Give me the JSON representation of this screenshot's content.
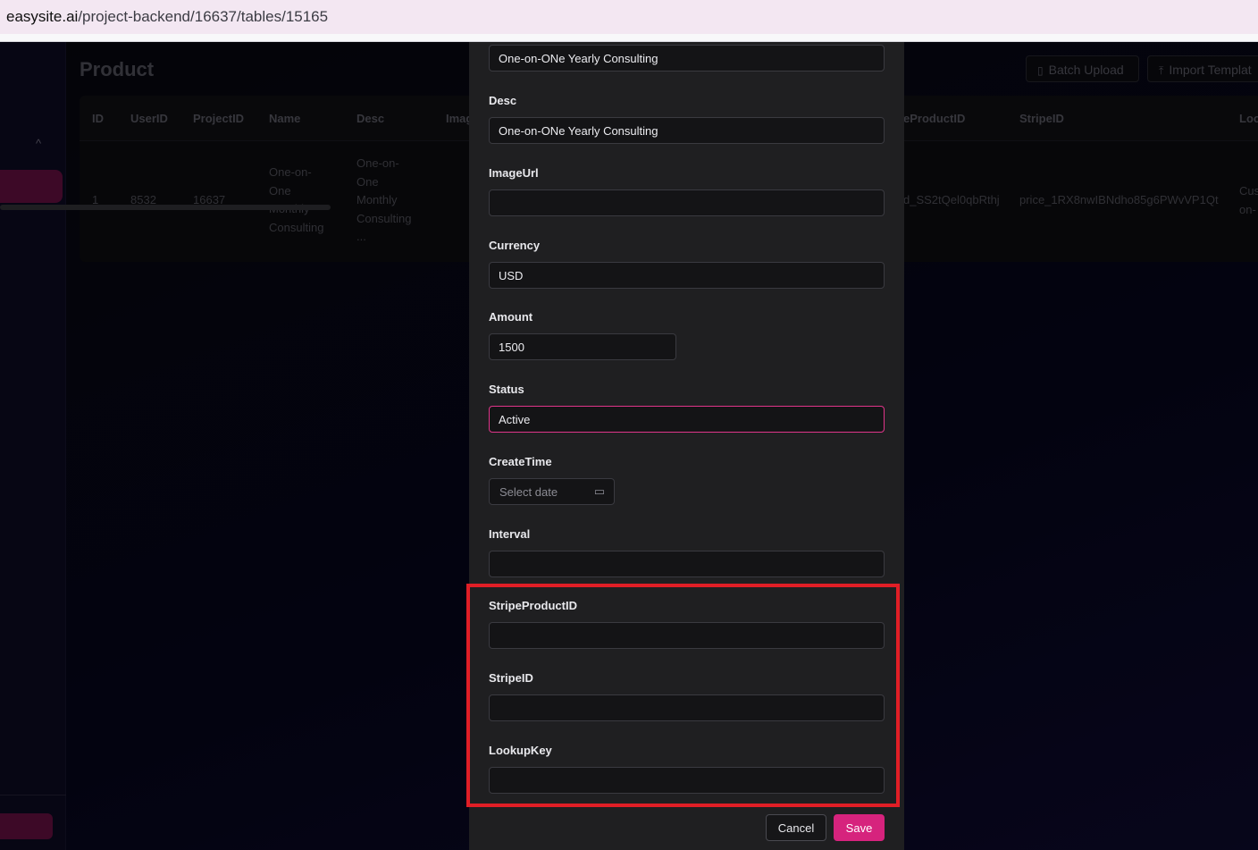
{
  "browser": {
    "url_host": "easysite.ai",
    "url_path": "/project-backend/16637/tables/15165"
  },
  "background": {
    "page_title": "Product",
    "buttons": {
      "batch_upload": "Batch Upload",
      "import_template": "Import Templat"
    },
    "table": {
      "headers": [
        "ID",
        "UserID",
        "ProjectID",
        "Name",
        "Desc",
        "Imag",
        "eProductID",
        "StripeID",
        "Loo"
      ],
      "row": {
        "id": "1",
        "user_id": "8532",
        "project_id": "16637",
        "name": "One-on-One Monthly Consulting",
        "desc": "One-on-One Monthly Consulting ...",
        "product_id": "d_SS2tQel0qbRthj",
        "stripe_id": "price_1RX8nwIBNdho85g6PWvVP1Qt",
        "lookup": "Cus on-"
      }
    }
  },
  "modal": {
    "fields": {
      "name": {
        "value": "One-on-ONe Yearly Consulting"
      },
      "desc": {
        "label": "Desc",
        "value": "One-on-ONe Yearly Consulting"
      },
      "image_url": {
        "label": "ImageUrl",
        "value": ""
      },
      "currency": {
        "label": "Currency",
        "value": "USD"
      },
      "amount": {
        "label": "Amount",
        "value": "1500"
      },
      "status": {
        "label": "Status",
        "value": "Active"
      },
      "create_time": {
        "label": "CreateTime",
        "placeholder": "Select date"
      },
      "interval": {
        "label": "Interval",
        "value": ""
      },
      "stripe_product_id": {
        "label": "StripeProductID",
        "value": ""
      },
      "stripe_id": {
        "label": "StripeID",
        "value": ""
      },
      "lookup_key": {
        "label": "LookupKey",
        "value": ""
      }
    },
    "buttons": {
      "cancel": "Cancel",
      "save": "Save"
    }
  },
  "colors": {
    "accent": "#d6237d",
    "highlight_border": "#e01e26",
    "modal_bg": "#1f1f21"
  }
}
